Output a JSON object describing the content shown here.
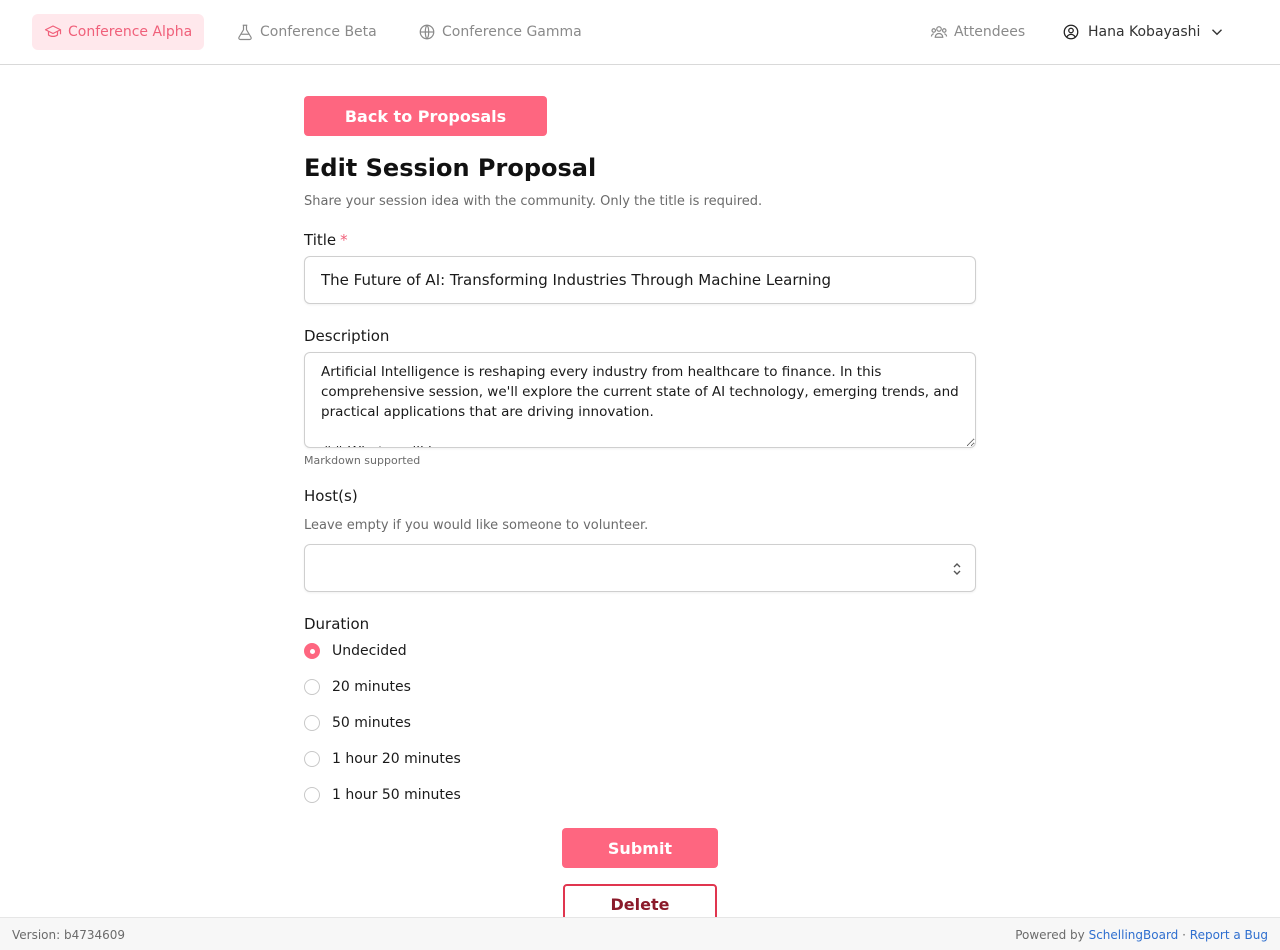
{
  "nav": {
    "tabs": [
      {
        "label": "Conference Alpha",
        "icon": "graduation-cap-icon",
        "active": true
      },
      {
        "label": "Conference Beta",
        "icon": "flask-icon",
        "active": false
      },
      {
        "label": "Conference Gamma",
        "icon": "globe-icon",
        "active": false
      }
    ],
    "attendees_label": "Attendees",
    "user_name": "Hana Kobayashi"
  },
  "page": {
    "back_label": "Back to Proposals",
    "title": "Edit Session Proposal",
    "subtitle": "Share your session idea with the community. Only the title is required."
  },
  "form": {
    "title_label": "Title",
    "required_mark": "*",
    "title_value": "The Future of AI: Transforming Industries Through Machine Learning",
    "description_label": "Description",
    "description_value": "Artificial Intelligence is reshaping every industry from healthcare to finance. In this comprehensive session, we'll explore the current state of AI technology, emerging trends, and practical applications that are driving innovation.\n\n## What you'll learn",
    "markdown_hint": "Markdown supported",
    "hosts_label": "Host(s)",
    "hosts_hint": "Leave empty if you would like someone to volunteer.",
    "hosts_value": "",
    "duration_label": "Duration",
    "duration_options": [
      "Undecided",
      "20 minutes",
      "50 minutes",
      "1 hour 20 minutes",
      "1 hour 50 minutes"
    ],
    "duration_selected": "Undecided",
    "submit_label": "Submit",
    "delete_label": "Delete"
  },
  "footer": {
    "version": "Version: b4734609",
    "powered_prefix": "Powered by",
    "powered_link": "SchellingBoard",
    "separator": "·",
    "bug_link": "Report a Bug"
  },
  "colors": {
    "accent": "#fe6680",
    "accent_light": "#ffe8ec",
    "delete_border": "#e0354f",
    "link": "#2f6fcf"
  }
}
